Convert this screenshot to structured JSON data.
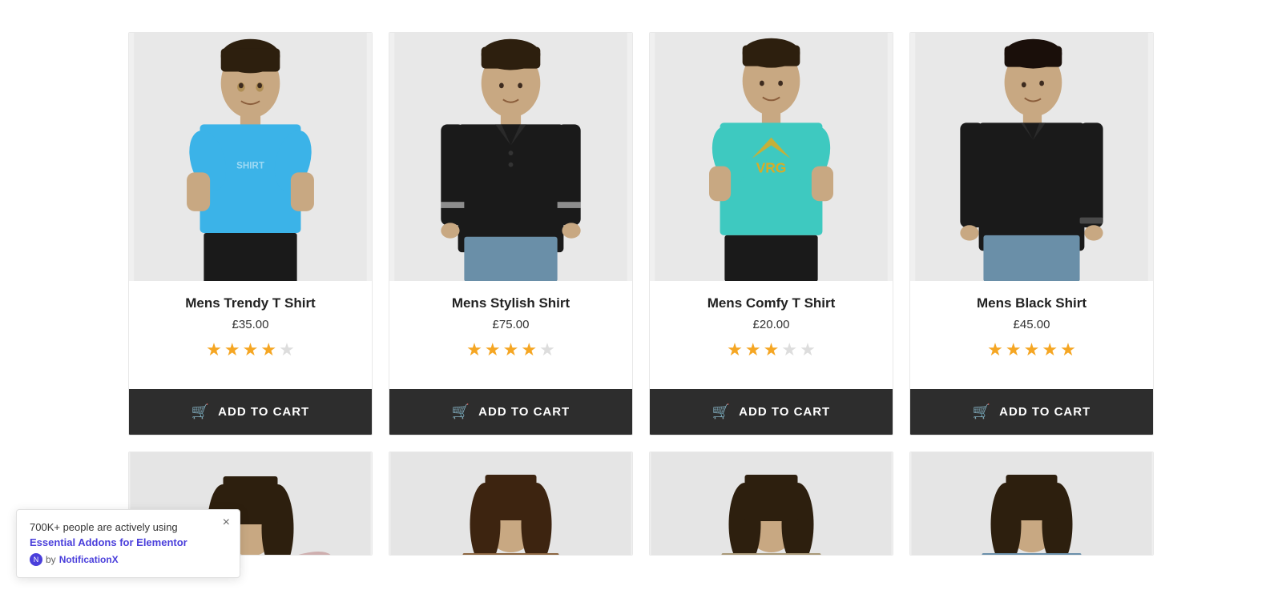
{
  "products": [
    {
      "id": "p1",
      "name": "Mens Trendy T Shirt",
      "price": "£35.00",
      "rating": 4,
      "max_rating": 5,
      "btn_label": "ADD TO CART",
      "color": "#3bb3e8",
      "type": "male-tshirt"
    },
    {
      "id": "p2",
      "name": "Mens Stylish Shirt",
      "price": "£75.00",
      "rating": 4,
      "max_rating": 5,
      "btn_label": "ADD TO CART",
      "color": "#1a1a1a",
      "type": "male-shirt"
    },
    {
      "id": "p3",
      "name": "Mens Comfy T Shirt",
      "price": "£20.00",
      "rating": 3,
      "max_rating": 5,
      "btn_label": "ADD TO CART",
      "color": "#3ec9c0",
      "type": "male-tshirt-2"
    },
    {
      "id": "p4",
      "name": "Mens Black Shirt",
      "price": "£45.00",
      "rating": 5,
      "max_rating": 5,
      "btn_label": "ADD TO CART",
      "color": "#1a1a1a",
      "type": "male-shirt-2"
    }
  ],
  "partial_products": [
    {
      "id": "pp1",
      "type": "female"
    },
    {
      "id": "pp2",
      "type": "female"
    },
    {
      "id": "pp3",
      "type": "female"
    },
    {
      "id": "pp4",
      "type": "female"
    }
  ],
  "notification": {
    "text": "700K+ people are actively using",
    "link_text": "Essential Addons for Elementor",
    "by_label": "by",
    "brand": "NotificationX",
    "close_label": "×"
  },
  "cart_icon": "🛒"
}
